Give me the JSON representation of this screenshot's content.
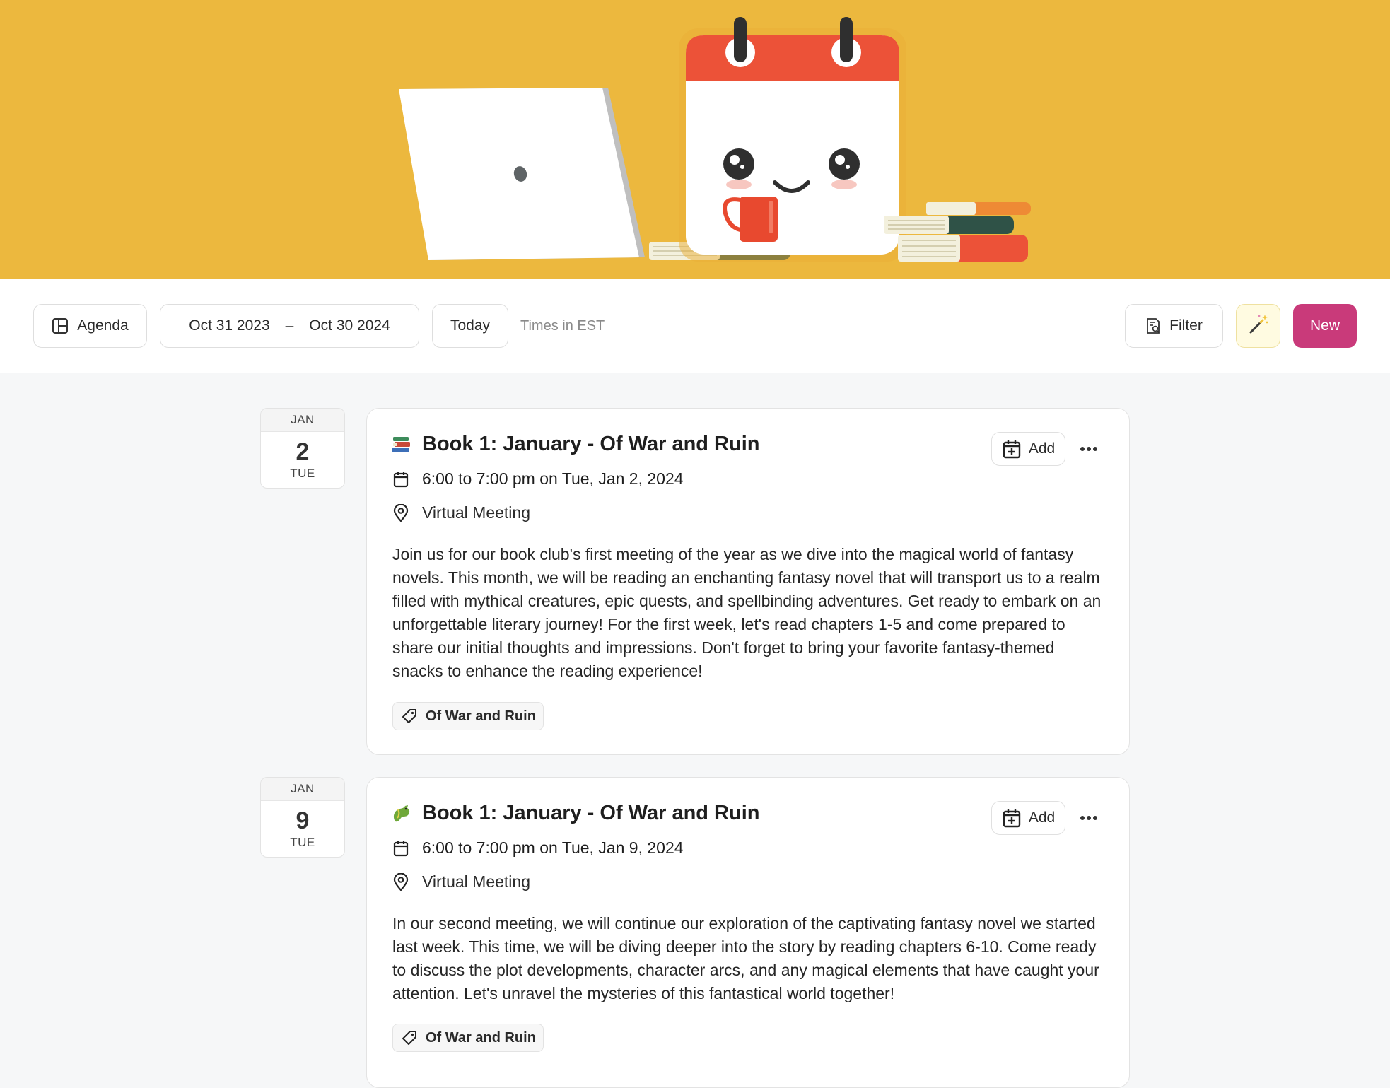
{
  "toolbar": {
    "view_label": "Agenda",
    "range_start": "Oct 31 2023",
    "range_separator": "–",
    "range_end": "Oct 30 2024",
    "today_label": "Today",
    "timezone_label": "Times in EST",
    "filter_label": "Filter",
    "magic_icon": "magic-wand-icon",
    "new_label": "New"
  },
  "colors": {
    "banner": "#ecb83e",
    "accent": "#c93a7a",
    "background": "#f6f7f8"
  },
  "events": [
    {
      "month": "JAN",
      "day": "2",
      "weekday": "TUE",
      "emoji_icon": "books-icon",
      "title": "Book 1: January - Of War and Ruin",
      "add_label": "Add",
      "time": "6:00 to 7:00 pm on Tue, Jan 2, 2024",
      "location": "Virtual Meeting",
      "description": "Join us for our book club's first meeting of the year as we dive into the magical world of fantasy novels. This month, we will be reading an enchanting fantasy novel that will transport us to a realm filled with mythical creatures, epic quests, and spellbinding adventures. Get ready to embark on an unforgettable literary journey! For the first week, let's read chapters 1-5 and come prepared to share our initial thoughts and impressions. Don't forget to bring your favorite fantasy-themed snacks to enhance the reading experience!",
      "tag": "Of War and Ruin"
    },
    {
      "month": "JAN",
      "day": "9",
      "weekday": "TUE",
      "emoji_icon": "dragon-icon",
      "title": "Book 1: January - Of War and Ruin",
      "add_label": "Add",
      "time": "6:00 to 7:00 pm on Tue, Jan 9, 2024",
      "location": "Virtual Meeting",
      "description": "In our second meeting, we will continue our exploration of the captivating fantasy novel we started last week. This time, we will be diving deeper into the story by reading chapters 6-10. Come ready to discuss the plot developments, character arcs, and any magical elements that have caught your attention. Let's unravel the mysteries of this fantastical world together!",
      "tag": "Of War and Ruin"
    }
  ]
}
